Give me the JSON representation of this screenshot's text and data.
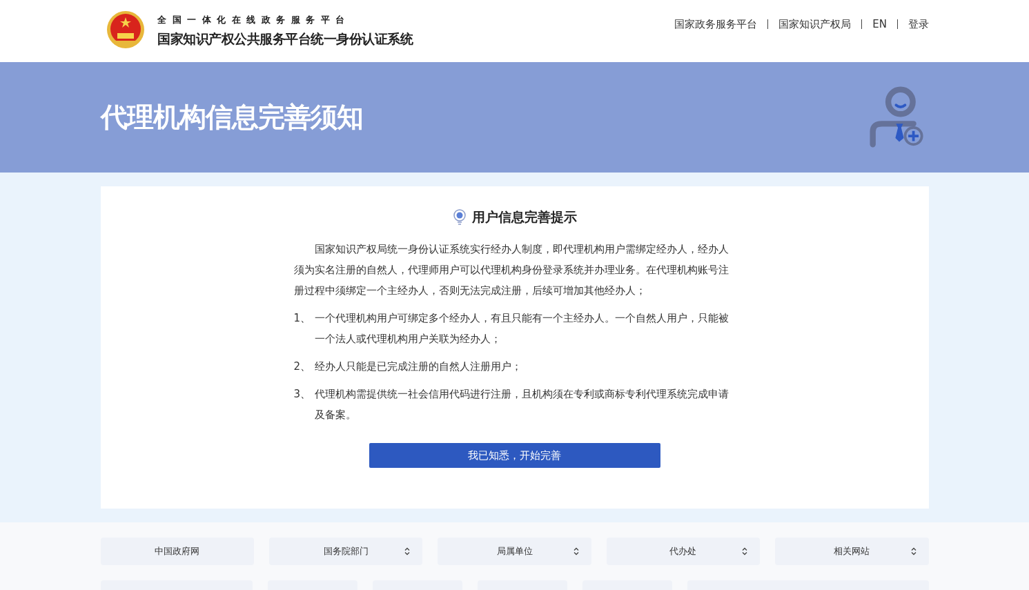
{
  "header": {
    "subtitle": "全国一体化在线政务服务平台",
    "title": "国家知识产权公共服务平台统一身份认证系统",
    "nav": [
      "国家政务服务平台",
      "国家知识产权局",
      "EN",
      "登录"
    ]
  },
  "banner": {
    "title": "代理机构信息完善须知"
  },
  "notice": {
    "heading": "用户信息完善提示",
    "intro": "国家知识产权局统一身份认证系统实行经办人制度，即代理机构用户需绑定经办人，经办人须为实名注册的自然人，代理师用户可以代理机构身份登录系统并办理业务。在代理机构账号注册过程中须绑定一个主经办人，否则无法完成注册，后续可增加其他经办人；",
    "items": [
      {
        "number": "1、",
        "text": "一个代理机构用户可绑定多个经办人，有且只能有一个主经办人。一个自然人用户，只能被一个法人或代理机构用户关联为经办人；"
      },
      {
        "number": "2、",
        "text": "经办人只能是已完成注册的自然人注册用户；"
      },
      {
        "number": "3、",
        "text": "代理机构需提供统一社会信用代码进行注册，且机构须在专利或商标专利代理系统完成申请及备案。"
      }
    ],
    "button": "我已知悉，开始完善"
  },
  "footer": {
    "links": [
      {
        "label": "中国政府网",
        "kind": "link"
      },
      {
        "label": "国务院部门",
        "kind": "dropdown"
      },
      {
        "label": "局属单位",
        "kind": "dropdown"
      },
      {
        "label": "代办处",
        "kind": "dropdown"
      },
      {
        "label": "相关网站",
        "kind": "dropdown"
      }
    ]
  }
}
